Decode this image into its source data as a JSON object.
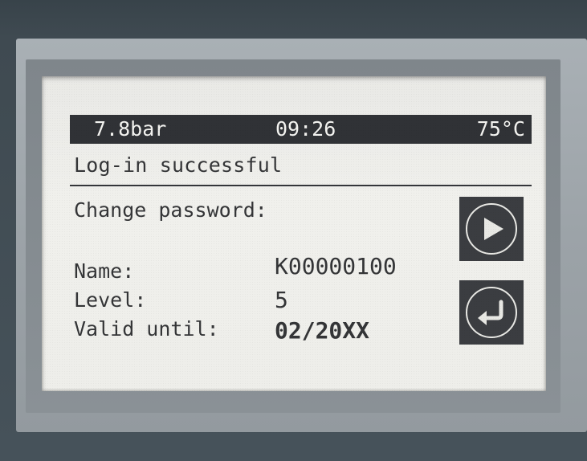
{
  "status_bar": {
    "pressure": "7.8bar",
    "time": "09:26",
    "temperature": "75°C"
  },
  "message": {
    "login_status": "Log-in successful",
    "change_password": "Change password:"
  },
  "user_info": {
    "name_label": "Name:",
    "name_value": "K00000100",
    "level_label": "Level:",
    "level_value": "5",
    "valid_label": "Valid until:",
    "valid_value": "02/20XX"
  },
  "buttons": {
    "next_icon": "play-arrow-icon",
    "back_icon": "return-enter-icon"
  },
  "colors": {
    "lcd_background": "#eeeeea",
    "status_bar": "#303236",
    "button": "#3b3d41",
    "text": "#343537",
    "bezel": "#9ca3a8"
  }
}
